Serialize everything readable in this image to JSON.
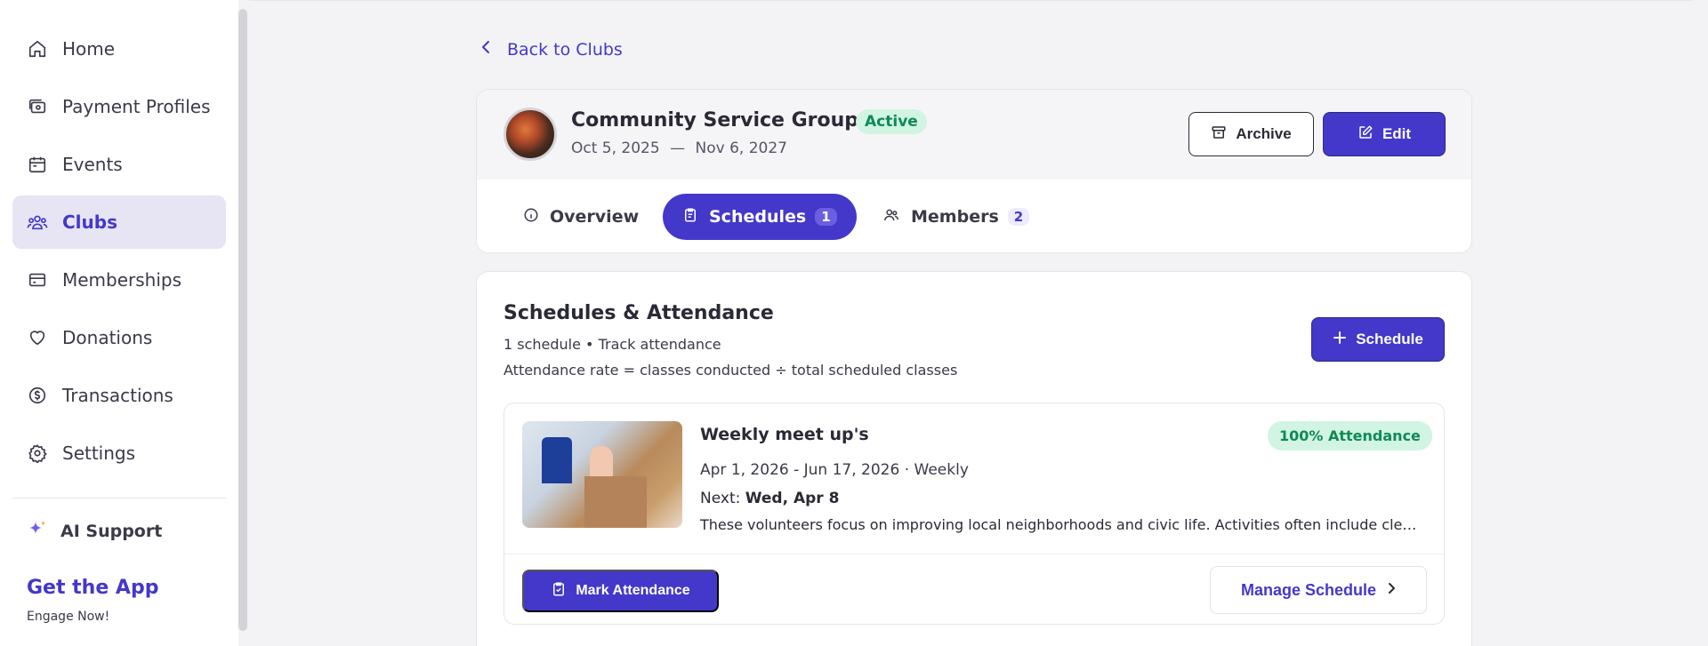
{
  "sidebar": {
    "items": [
      {
        "label": "Home",
        "icon": "home-icon"
      },
      {
        "label": "Payment Profiles",
        "icon": "wallet-icon"
      },
      {
        "label": "Events",
        "icon": "calendar-icon"
      },
      {
        "label": "Clubs",
        "icon": "users-icon",
        "active": true
      },
      {
        "label": "Memberships",
        "icon": "card-icon"
      },
      {
        "label": "Donations",
        "icon": "heart-icon"
      },
      {
        "label": "Transactions",
        "icon": "dollar-icon"
      },
      {
        "label": "Settings",
        "icon": "gear-icon"
      }
    ],
    "ai_support": "AI Support",
    "get_app": "Get the App",
    "engage": "Engage Now!"
  },
  "back_link": "Back to Clubs",
  "club": {
    "title": "Community Service Groups",
    "status": "Active",
    "start_date": "Oct 5, 2025",
    "separator": "—",
    "end_date": "Nov 6, 2027",
    "archive_label": "Archive",
    "edit_label": "Edit"
  },
  "tabs": [
    {
      "label": "Overview",
      "icon": "info-icon"
    },
    {
      "label": "Schedules",
      "icon": "clipboard-icon",
      "count": "1",
      "active": true
    },
    {
      "label": "Members",
      "icon": "users-icon",
      "count": "2"
    }
  ],
  "schedules": {
    "title": "Schedules & Attendance",
    "subtitle": "1 schedule • Track attendance",
    "rate_note": "Attendance rate = classes conducted ÷ total scheduled classes",
    "add_label": "Schedule",
    "items": [
      {
        "title": "Weekly meet up's",
        "attendance": "100% Attendance",
        "range": "Apr 1, 2026 - Jun 17, 2026 · Weekly",
        "next_prefix": "Next:",
        "next_value": "Wed, Apr 8",
        "description": "These volunteers focus on improving local neighborhoods and civic life. Activities often include cleaning parks, planting trees, and supporting local food banks.",
        "mark_label": "Mark Attendance",
        "manage_label": "Manage Schedule"
      }
    ]
  },
  "colors": {
    "accent": "#4338ca",
    "active_badge_bg": "#d1f4e3",
    "active_badge_text": "#0f8a55",
    "sidebar_active_bg": "#e7e4f4"
  }
}
